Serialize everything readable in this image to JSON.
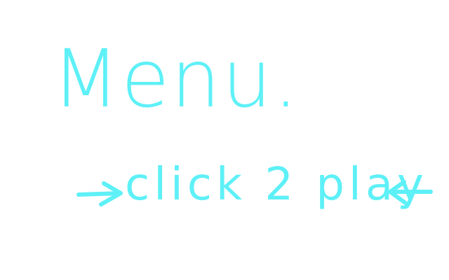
{
  "menu": {
    "title": "Menu.",
    "play_label": "click 2 play",
    "left_arrow_icon": "arrow-right-icon",
    "right_arrow_icon": "arrow-left-icon",
    "ink_color": "#5ef0f7",
    "background_color": "#ffffff"
  }
}
